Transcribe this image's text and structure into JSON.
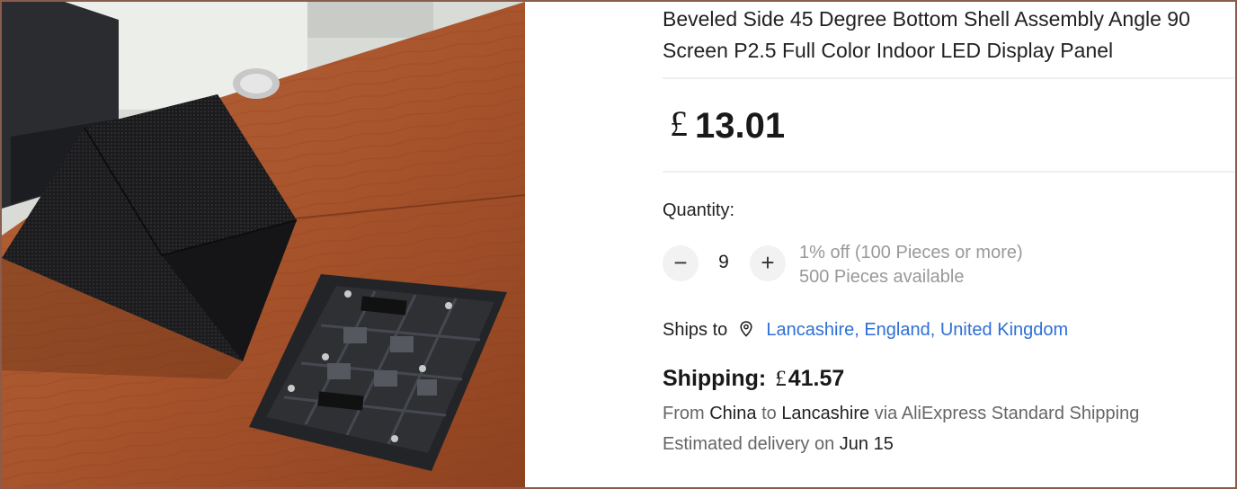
{
  "product": {
    "title_line1": "Beveled Side 45 Degree Bottom Shell Assembly Angle 90",
    "title_line2": "Screen P2.5 Full Color Indoor LED Display Panel",
    "image_alt": "LED display cube and module on wooden desk"
  },
  "price": {
    "currency_symbol": "£",
    "amount": "13.01"
  },
  "quantity": {
    "label": "Quantity:",
    "value": "9",
    "decrement_symbol": "−",
    "increment_symbol": "+",
    "discount_text": "1% off (100 Pieces or more)",
    "available_text": "500 Pieces available"
  },
  "shipping": {
    "ships_to_label": "Ships to",
    "destination": "Lancashire, England, United Kingdom",
    "cost_label": "Shipping:",
    "cost_currency": "£",
    "cost_amount": "41.57",
    "route_from_label": "From",
    "route_origin": "China",
    "route_to_label": "to",
    "route_destination": "Lancashire",
    "route_via": "via AliExpress Standard Shipping",
    "delivery_label": "Estimated delivery on",
    "delivery_date": "Jun 15"
  },
  "colors": {
    "link": "#2e6fd8",
    "muted": "#999999",
    "frame": "#8a5c4e"
  },
  "icons": [
    "location-pin-icon",
    "minus-icon",
    "plus-icon"
  ]
}
